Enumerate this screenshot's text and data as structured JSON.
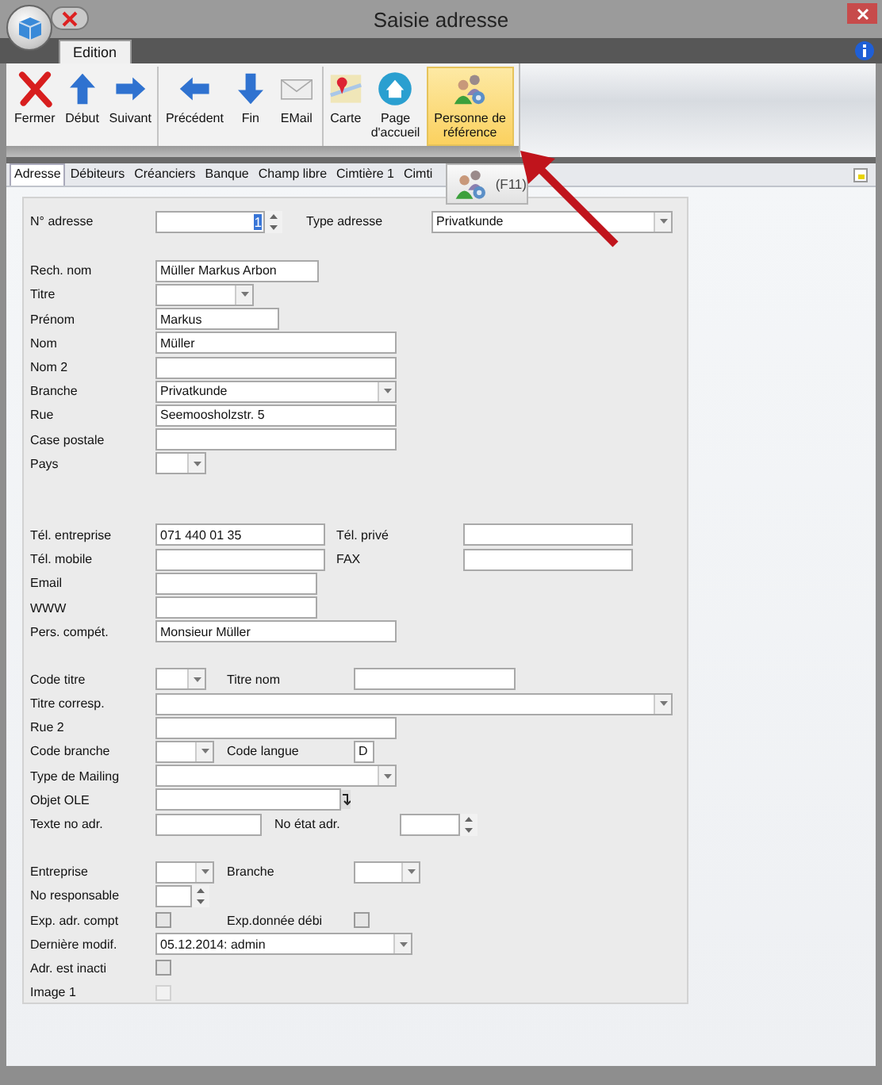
{
  "window": {
    "title": "Saisie adresse"
  },
  "ribbon_tabs": [
    {
      "label": "Edition",
      "selected": true
    }
  ],
  "ribbon": {
    "groups": [
      [
        {
          "label": "Fermer",
          "kind": "close",
          "highlighted": false
        },
        {
          "label": "Début",
          "kind": "up",
          "highlighted": false
        },
        {
          "label": "Suivant",
          "kind": "right",
          "highlighted": false
        }
      ],
      [
        {
          "label": "Précédent",
          "kind": "left",
          "highlighted": false
        },
        {
          "label": "Fin",
          "kind": "down",
          "highlighted": false
        },
        {
          "label": "EMail",
          "kind": "mail",
          "highlighted": false
        }
      ],
      [
        {
          "label": "Carte",
          "kind": "map",
          "highlighted": false
        },
        {
          "label": "Page d'accueil",
          "kind": "home",
          "highlighted": false
        },
        {
          "label": "Personne de référence",
          "kind": "people",
          "highlighted": true
        }
      ]
    ]
  },
  "tooltip": {
    "shortcut": "(F11)"
  },
  "tabs": [
    {
      "label": "Adresse",
      "selected": true
    },
    {
      "label": "Débiteurs",
      "selected": false
    },
    {
      "label": "Créanciers",
      "selected": false
    },
    {
      "label": "Banque",
      "selected": false
    },
    {
      "label": "Champ libre",
      "selected": false
    },
    {
      "label": "Cimtière 1",
      "selected": false
    },
    {
      "label": "Cimti",
      "selected": false
    }
  ],
  "form": {
    "sections": [
      [
        [
          {
            "kind": "label",
            "text": "N° adresse"
          },
          {
            "kind": "spin",
            "value": "1",
            "text_selected": true
          },
          {
            "kind": "label",
            "text": "Type adresse"
          },
          {
            "kind": "combo",
            "value": "Privatkunde"
          }
        ]
      ],
      [
        [
          {
            "kind": "label",
            "text": "Rech. nom"
          },
          {
            "kind": "field",
            "value": "Müller Markus Arbon"
          }
        ],
        [
          {
            "kind": "label",
            "text": "Titre"
          },
          {
            "kind": "combo"
          }
        ],
        [
          {
            "kind": "label",
            "text": "Prénom"
          },
          {
            "kind": "field",
            "value": "Markus"
          }
        ],
        [
          {
            "kind": "label",
            "text": "Nom"
          },
          {
            "kind": "field",
            "value": "Müller"
          }
        ],
        [
          {
            "kind": "label",
            "text": "Nom 2"
          },
          {
            "kind": "field"
          }
        ],
        [
          {
            "kind": "label",
            "text": "Branche"
          },
          {
            "kind": "combo",
            "value": "Privatkunde"
          }
        ],
        [
          {
            "kind": "label",
            "text": "Rue"
          },
          {
            "kind": "field",
            "value": "Seemoosholzstr. 5"
          }
        ],
        [
          {
            "kind": "label",
            "text": "Case postale"
          },
          {
            "kind": "field"
          }
        ],
        [
          {
            "kind": "label",
            "text": "Pays"
          },
          {
            "kind": "combo"
          }
        ]
      ],
      [
        [
          {
            "kind": "label",
            "text": "Tél. entreprise"
          },
          {
            "kind": "field",
            "value": "071 440 01 35"
          },
          {
            "kind": "label",
            "text": "Tél. privé"
          },
          {
            "kind": "field"
          }
        ],
        [
          {
            "kind": "label",
            "text": "Tél. mobile"
          },
          {
            "kind": "field"
          },
          {
            "kind": "label",
            "text": "FAX"
          },
          {
            "kind": "field"
          }
        ],
        [
          {
            "kind": "label",
            "text": "Email"
          },
          {
            "kind": "field"
          }
        ],
        [
          {
            "kind": "label",
            "text": "WWW"
          },
          {
            "kind": "field"
          }
        ],
        [
          {
            "kind": "label",
            "text": "Pers. compét."
          },
          {
            "kind": "field",
            "value": "Monsieur Müller"
          }
        ]
      ],
      [
        [
          {
            "kind": "label",
            "text": "Code titre"
          },
          {
            "kind": "combo"
          },
          {
            "kind": "label",
            "text": "Titre nom"
          },
          {
            "kind": "field"
          }
        ],
        [
          {
            "kind": "label",
            "text": "Titre corresp."
          },
          {
            "kind": "combo"
          }
        ],
        [
          {
            "kind": "label",
            "text": "Rue  2"
          },
          {
            "kind": "field"
          }
        ],
        [
          {
            "kind": "label",
            "text": "Code branche"
          },
          {
            "kind": "combo"
          },
          {
            "kind": "label",
            "text": "Code langue"
          },
          {
            "kind": "field",
            "value": "D"
          }
        ],
        [
          {
            "kind": "label",
            "text": "Type de Mailing"
          },
          {
            "kind": "combo"
          }
        ],
        [
          {
            "kind": "label",
            "text": "Objet OLE"
          },
          {
            "kind": "ole"
          }
        ],
        [
          {
            "kind": "label",
            "text": "Texte no adr."
          },
          {
            "kind": "field"
          },
          {
            "kind": "label",
            "text": "No état adr."
          },
          {
            "kind": "spin"
          }
        ]
      ],
      [
        [
          {
            "kind": "label",
            "text": "Entreprise"
          },
          {
            "kind": "combo"
          },
          {
            "kind": "label",
            "text": "Branche"
          },
          {
            "kind": "combo"
          }
        ],
        [
          {
            "kind": "label",
            "text": "No responsable"
          },
          {
            "kind": "spin"
          }
        ],
        [
          {
            "kind": "label",
            "text": "Exp. adr. compt"
          },
          {
            "kind": "check",
            "checked": false,
            "disabled": false
          },
          {
            "kind": "label",
            "text": "Exp.donnée débi"
          },
          {
            "kind": "check",
            "checked": false,
            "disabled": false
          }
        ],
        [
          {
            "kind": "label",
            "text": "Dernière modif."
          },
          {
            "kind": "combo",
            "value": "05.12.2014: admin"
          }
        ],
        [
          {
            "kind": "label",
            "text": "Adr. est inacti"
          },
          {
            "kind": "check",
            "checked": false,
            "disabled": false
          }
        ],
        [
          {
            "kind": "label",
            "text": "Image 1"
          },
          {
            "kind": "check",
            "checked": false,
            "disabled": true
          }
        ]
      ]
    ]
  }
}
